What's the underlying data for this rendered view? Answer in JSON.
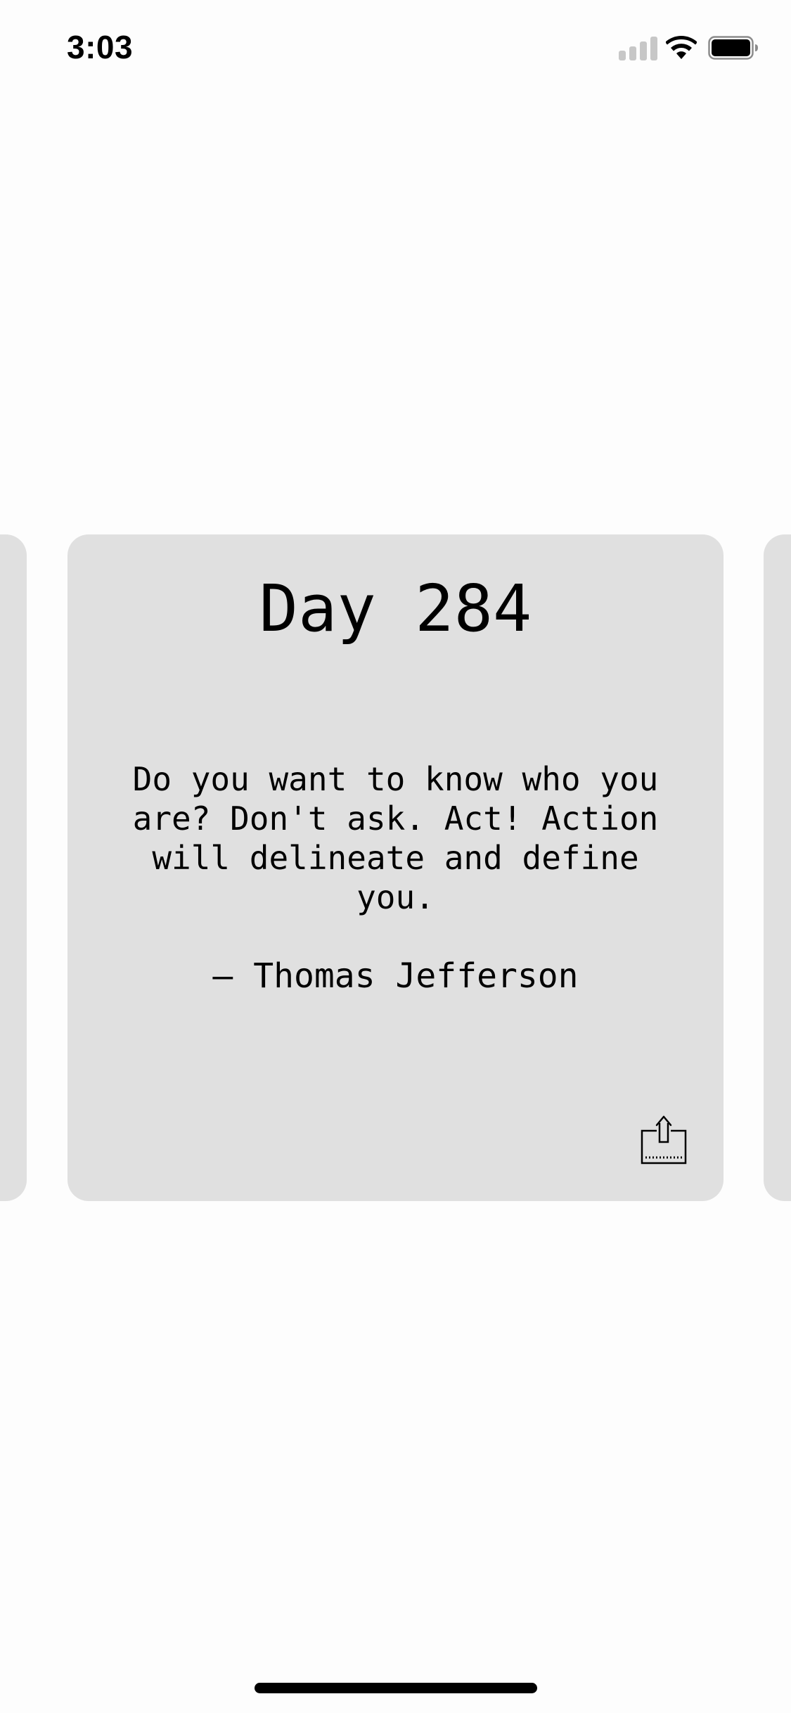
{
  "status_bar": {
    "time": "3:03",
    "signal_icon": "cellular-signal-icon",
    "wifi_icon": "wifi-icon",
    "battery_icon": "battery-icon"
  },
  "card": {
    "day_title": "Day 284",
    "quote": "Do you want to know who you are? Don't ask. Act! Action will delineate and define you.",
    "author": "— Thomas Jefferson",
    "share_icon": "share-icon"
  },
  "colors": {
    "card_background": "#e0e0e0",
    "page_background": "#fdfdfd",
    "text": "#000000"
  }
}
